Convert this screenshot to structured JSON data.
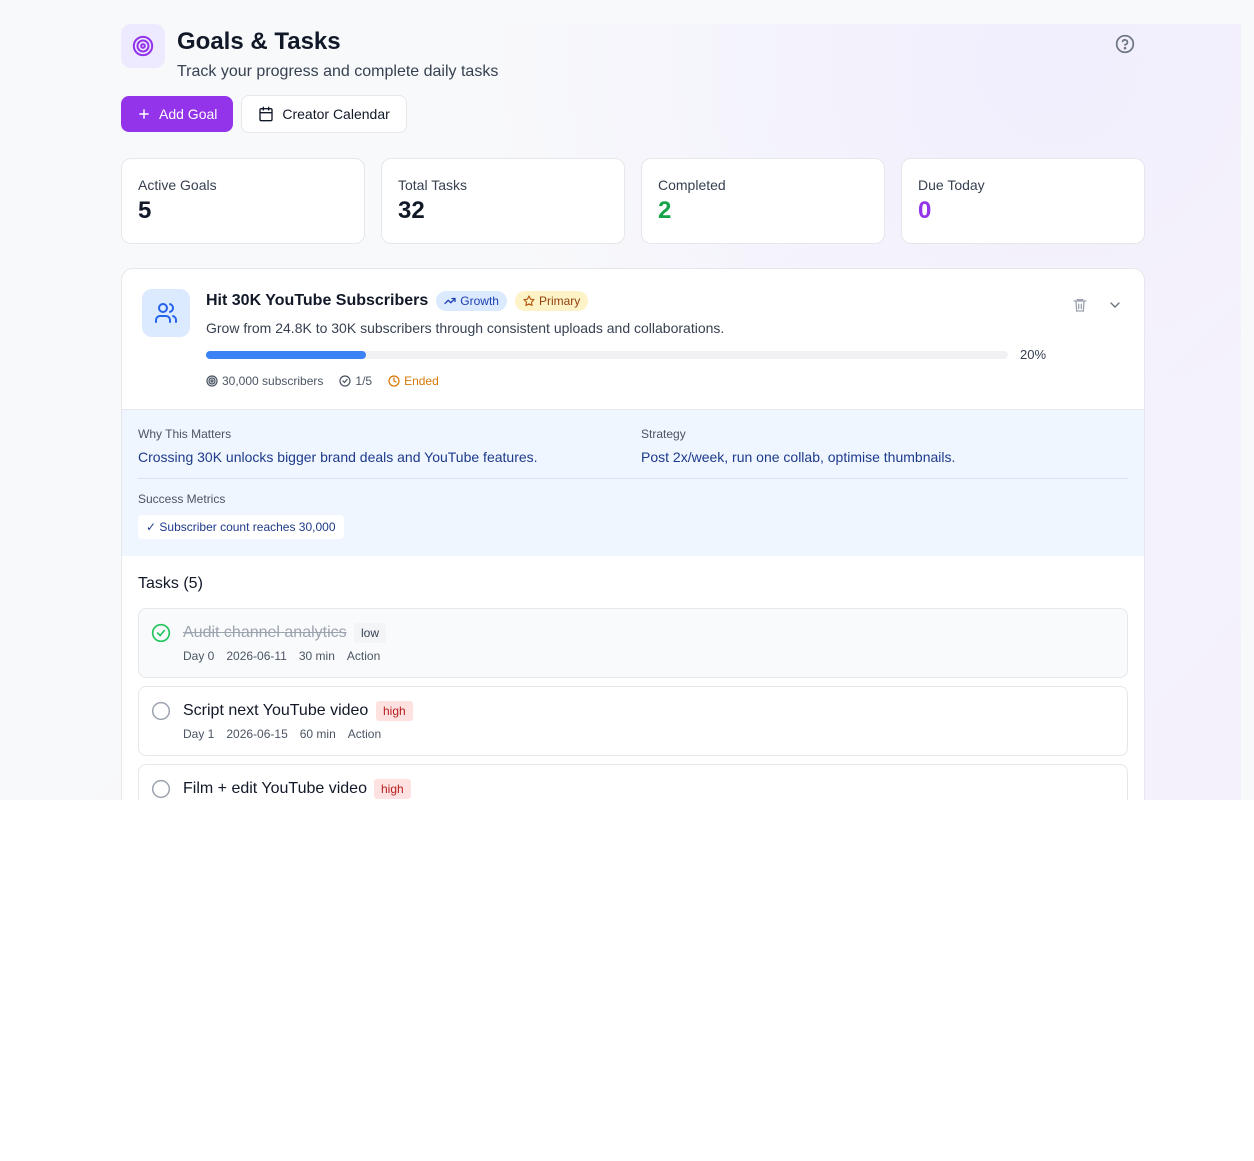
{
  "header": {
    "title": "Goals & Tasks",
    "subtitle": "Track your progress and complete daily tasks"
  },
  "actions": {
    "add_goal": "Add Goal",
    "creator_calendar": "Creator Calendar"
  },
  "stats": [
    {
      "label": "Active Goals",
      "value": "5",
      "color": "#111827"
    },
    {
      "label": "Total Tasks",
      "value": "32",
      "color": "#111827"
    },
    {
      "label": "Completed",
      "value": "2",
      "color": "#16a34a"
    },
    {
      "label": "Due Today",
      "value": "0",
      "color": "#9333ea"
    }
  ],
  "goal": {
    "title": "Hit 30K YouTube Subscribers",
    "category": "Growth",
    "priority_tag": "Primary",
    "description": "Grow from 24.8K to 30K subscribers through consistent uploads and collaborations.",
    "progress": 0.2,
    "progress_label": "20%",
    "target": "30,000 subscribers",
    "tasks_done": "1/5",
    "status": "Ended",
    "why_label": "Why This Matters",
    "why_text": "Crossing 30K unlocks bigger brand deals and YouTube features.",
    "strategy_label": "Strategy",
    "strategy_text": "Post 2x/week, run one collab, optimise thumbnails.",
    "metrics_label": "Success Metrics",
    "metric": "✓ Subscriber count reaches 30,000"
  },
  "tasks": {
    "title": "Tasks (5)",
    "items": [
      {
        "name": "Audit channel analytics",
        "priority": "low",
        "day": "Day 0",
        "date": "2026-06-11",
        "duration": "30 min",
        "type": "Action",
        "done": true
      },
      {
        "name": "Script next YouTube video",
        "priority": "high",
        "day": "Day 1",
        "date": "2026-06-15",
        "duration": "60 min",
        "type": "Action",
        "done": false
      },
      {
        "name": "Film + edit YouTube video",
        "priority": "high",
        "done": false
      }
    ]
  },
  "colors": {
    "accent": "#9333ea",
    "progress": "#3b82f6",
    "ended": "#d97706"
  }
}
